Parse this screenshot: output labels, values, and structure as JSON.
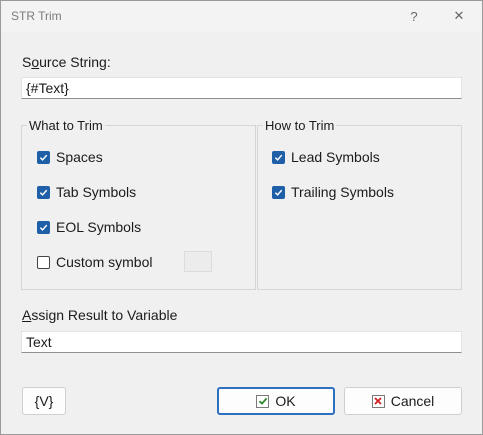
{
  "window": {
    "title": "STR Trim",
    "help_glyph": "?",
    "close_glyph": "✕"
  },
  "source": {
    "label_first": "S",
    "label_underlined": "o",
    "label_rest": "urce String:",
    "value": "{#Text}"
  },
  "what_to_trim": {
    "title": "What to Trim",
    "items": [
      {
        "label": "Spaces",
        "checked": true
      },
      {
        "label": "Tab Symbols",
        "checked": true
      },
      {
        "label": "EOL Symbols",
        "checked": true
      },
      {
        "label": "Custom symbol",
        "checked": false
      }
    ]
  },
  "how_to_trim": {
    "title": "How to Trim",
    "items": [
      {
        "label": "Lead Symbols",
        "checked": true
      },
      {
        "label": "Trailing Symbols",
        "checked": true
      }
    ]
  },
  "assign": {
    "label_underlined": "A",
    "label_rest": "ssign Result to Variable",
    "value": "Text"
  },
  "buttons": {
    "variables": "{V}",
    "ok": "OK",
    "cancel": "Cancel"
  },
  "colors": {
    "checkbox_accent": "#1f5fa8",
    "ok_border": "#2f6fc0",
    "ok_icon": "#2b8a2b",
    "cancel_icon": "#d42020"
  },
  "icons": {
    "ok": "check-icon",
    "cancel": "x-icon",
    "help": "help-icon",
    "close": "close-icon"
  }
}
